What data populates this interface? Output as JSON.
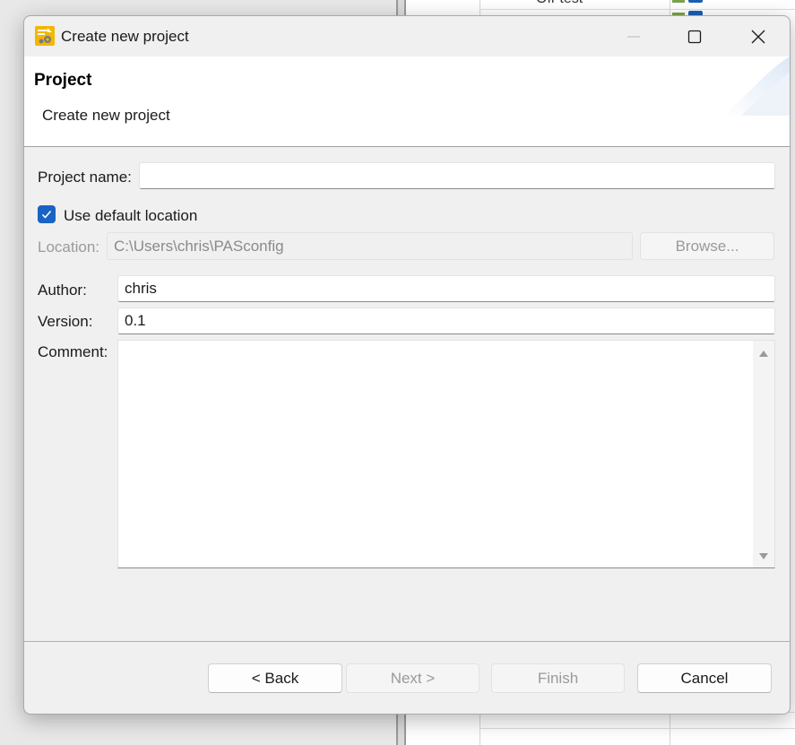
{
  "background": {
    "partial_text": "Off-test"
  },
  "window": {
    "title": "Create new project",
    "minimize_label": "Minimize",
    "maximize_label": "Maximize",
    "close_label": "Close"
  },
  "header": {
    "title": "Project",
    "subtitle": "Create new project"
  },
  "form": {
    "project_name_label": "Project name:",
    "project_name_value": "",
    "use_default_location_label": "Use default location",
    "use_default_location_checked": true,
    "location_label": "Location:",
    "location_value": "C:\\Users\\chris\\PASconfig",
    "browse_label": "Browse...",
    "author_label": "Author:",
    "author_value": "chris",
    "version_label": "Version:",
    "version_value": "0.1",
    "comment_label": "Comment:",
    "comment_value": ""
  },
  "buttons": {
    "back": "< Back",
    "next": "Next >",
    "finish": "Finish",
    "cancel": "Cancel"
  },
  "colors": {
    "accent": "#1a63c4",
    "dialog_bg": "#f0f0f0",
    "header_bg": "#ffffff"
  }
}
